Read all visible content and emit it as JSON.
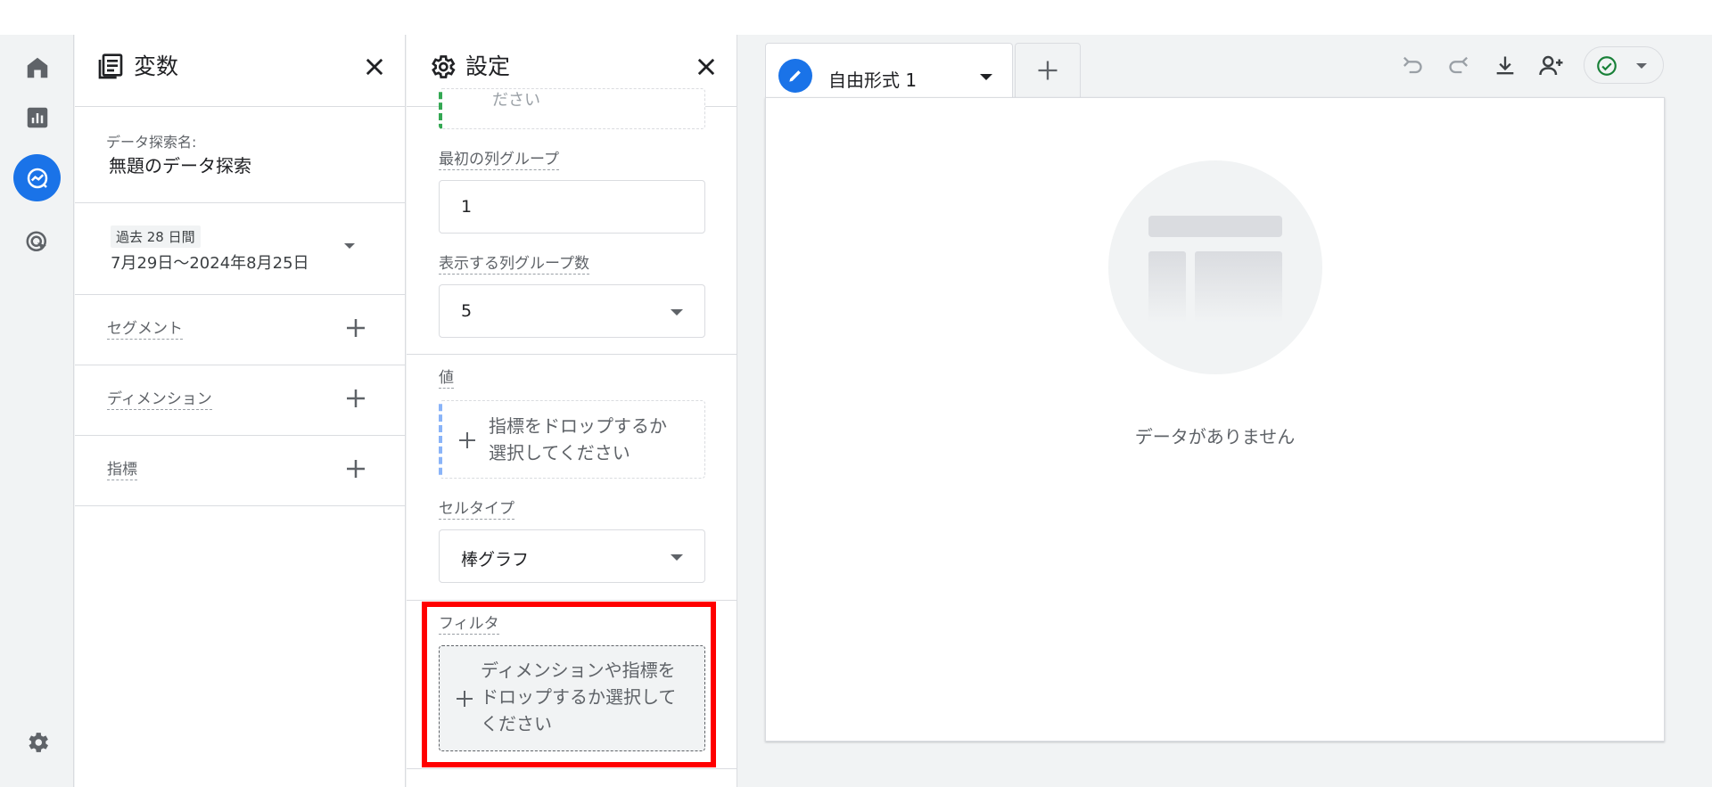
{
  "rail": {
    "items": [
      "home-icon",
      "reports-icon",
      "explore-icon",
      "advertising-icon"
    ],
    "active": "explore-icon",
    "bottom": "admin-gear-icon"
  },
  "variables": {
    "title": "変数",
    "exploration_name_label": "データ探索名:",
    "exploration_name_value": "無題のデータ探索",
    "date_chip": "過去 28 日間",
    "date_range": "7月29日～2024年8月25日",
    "segments_label": "セグメント",
    "dimensions_label": "ディメンション",
    "metrics_label": "指標"
  },
  "settings": {
    "title": "設定",
    "first_column_group_label": "最初の列グループ",
    "first_column_group_value": "1",
    "show_column_groups_label": "表示する列グループ数",
    "show_column_groups_value": "5",
    "values_label": "値",
    "values_drop_line1": "指標をドロップするか",
    "values_drop_line2": "選択してください",
    "cell_type_label": "セルタイプ",
    "cell_type_value": "棒グラフ",
    "filter_label": "フィルタ",
    "filter_drop_line1": "ディメンションや指標を",
    "filter_drop_line2": "ドロップするか選択して",
    "filter_drop_line3": "ください",
    "partial_text": "ださい"
  },
  "canvas": {
    "tab_label": "自由形式 1",
    "empty_text": "データがありません"
  },
  "colors": {
    "accent": "#1a73e8",
    "highlight": "#ff0000",
    "success": "#188038"
  }
}
